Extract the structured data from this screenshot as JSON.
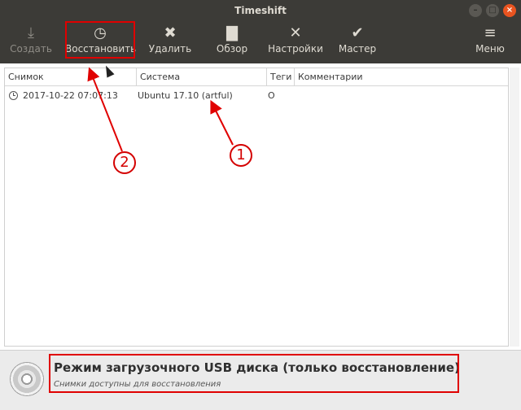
{
  "window": {
    "title": "Timeshift"
  },
  "toolbar": {
    "buttons": [
      {
        "id": "create",
        "label": "Создать",
        "icon": "download-icon",
        "glyph": "⤓",
        "disabled": true
      },
      {
        "id": "restore",
        "label": "Восстановить",
        "icon": "clock-icon",
        "glyph": "◷",
        "disabled": false
      },
      {
        "id": "delete",
        "label": "Удалить",
        "icon": "close-circle-icon",
        "glyph": "✖",
        "disabled": false
      },
      {
        "id": "browse",
        "label": "Обзор",
        "icon": "folder-icon",
        "glyph": "▇",
        "disabled": false
      },
      {
        "id": "settings",
        "label": "Настройки",
        "icon": "tools-icon",
        "glyph": "✕",
        "disabled": false
      },
      {
        "id": "wizard",
        "label": "Мастер",
        "icon": "checkmark-icon",
        "glyph": "✔",
        "disabled": false
      },
      {
        "id": "menu",
        "label": "Меню",
        "icon": "hamburger-icon",
        "glyph": "≡",
        "disabled": false
      }
    ]
  },
  "table": {
    "columns": [
      "Снимок",
      "Система",
      "Теги",
      "Комментарии"
    ],
    "rows": [
      {
        "snapshot": "2017-10-22 07:07:13",
        "system": "Ubuntu 17.10 (artful)",
        "tags": "O",
        "comments": ""
      }
    ]
  },
  "status": {
    "title": "Режим загрузочного USB диска (только восстановление)",
    "subtitle": "Снимки доступны для восстановления"
  },
  "annotations": {
    "badge1": "1",
    "badge2": "2",
    "color": "#e00000"
  }
}
